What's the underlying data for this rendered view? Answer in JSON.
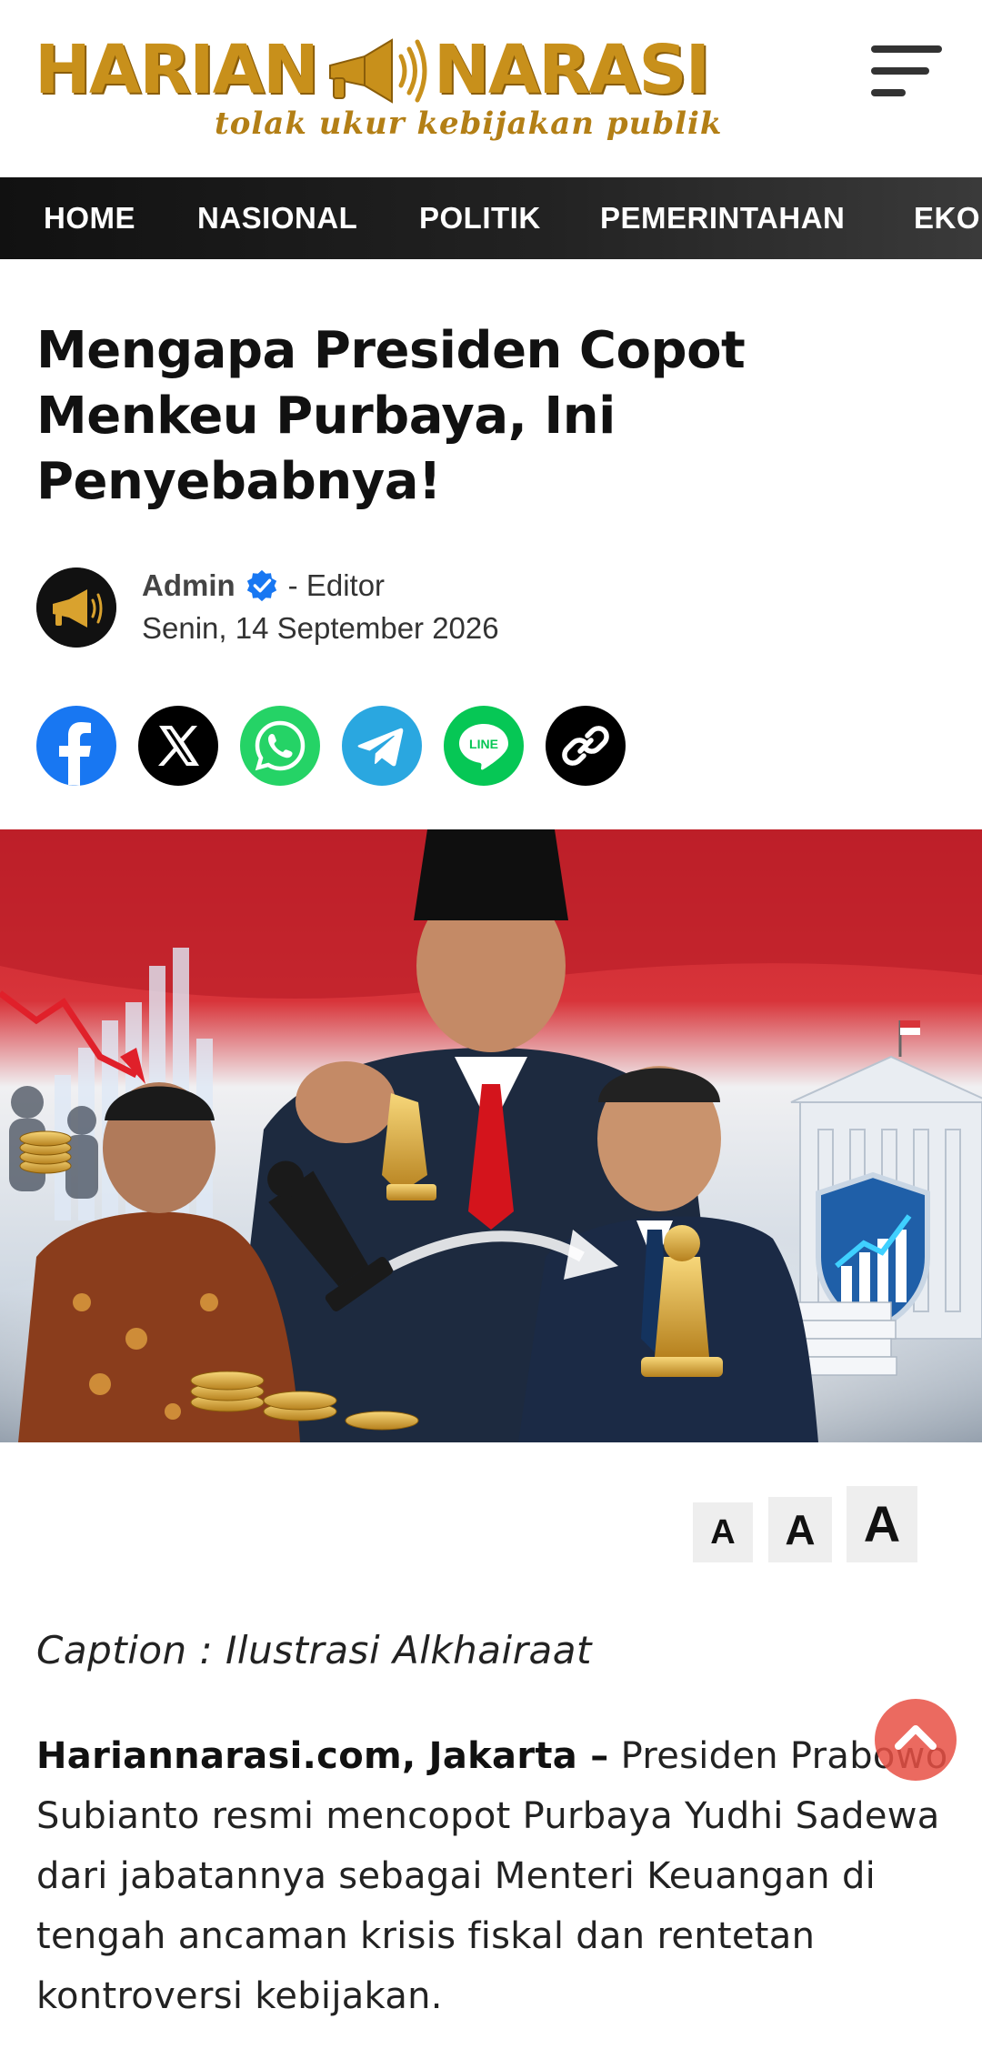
{
  "header": {
    "logo_left": "HARIAN",
    "logo_right": "NARASI",
    "tagline": "tolak ukur kebijakan publik"
  },
  "nav": {
    "items": [
      "HOME",
      "NASIONAL",
      "POLITIK",
      "PEMERINTAHAN",
      "EKO"
    ]
  },
  "article": {
    "title": "Mengapa Presiden Copot Menkeu Purbaya, Ini Penyebabnya!",
    "author": "Admin",
    "role": "- Editor",
    "date": "Senin, 14 September 2026",
    "caption": "Caption : Ilustrasi Alkhairaat",
    "lead": "Hariannarasi.com, Jakarta –",
    "body": " Presiden Prabowo Subianto resmi mencopot Purbaya Yudhi Sadewa dari jabatannya sebagai Menteri Keuangan di tengah ancaman krisis fiskal dan rentetan kontroversi kebijakan."
  },
  "share": {
    "icons": [
      "facebook-icon",
      "x-icon",
      "whatsapp-icon",
      "telegram-icon",
      "line-icon",
      "link-icon"
    ],
    "line_label": "LINE"
  },
  "font_size": {
    "small": "A",
    "medium": "A",
    "large": "A"
  },
  "colors": {
    "brand_gold": "#c8901b",
    "nav_bg": "#111111",
    "facebook": "#1877f2",
    "whatsapp": "#25d366",
    "telegram": "#2aa7e0",
    "line": "#06c755",
    "scroll_top": "#e85044"
  }
}
